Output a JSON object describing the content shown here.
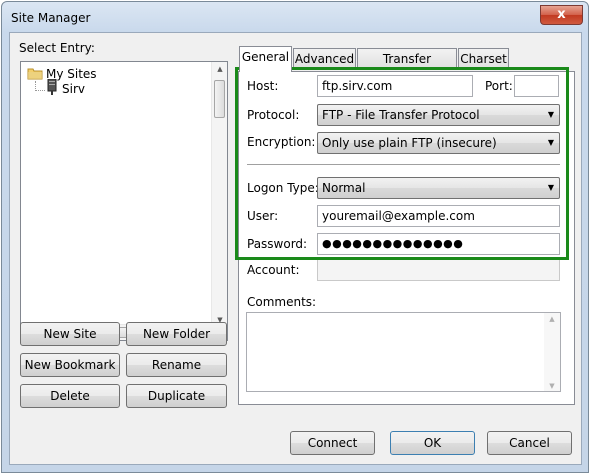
{
  "window": {
    "title": "Site Manager",
    "close_glyph": "x"
  },
  "left": {
    "select_label": "Select Entry:",
    "tree": {
      "root": "My Sites",
      "child": "Sirv"
    },
    "buttons": {
      "new_site": "New Site",
      "new_folder": "New Folder",
      "new_bookmark": "New Bookmark",
      "rename": "Rename",
      "delete": "Delete",
      "duplicate": "Duplicate"
    }
  },
  "tabs": [
    "General",
    "Advanced",
    "Transfer Settings",
    "Charset"
  ],
  "form": {
    "host_label": "Host:",
    "host_value": "ftp.sirv.com",
    "port_label": "Port:",
    "port_value": "",
    "protocol_label": "Protocol:",
    "protocol_value": "FTP - File Transfer Protocol",
    "encryption_label": "Encryption:",
    "encryption_value": "Only use plain FTP (insecure)",
    "logon_label": "Logon Type:",
    "logon_value": "Normal",
    "user_label": "User:",
    "user_value": "youremail@example.com",
    "password_label": "Password:",
    "password_value": "●●●●●●●●●●●●●●",
    "account_label": "Account:",
    "comments_label": "Comments:"
  },
  "footer": {
    "connect": "Connect",
    "ok": "OK",
    "cancel": "Cancel"
  },
  "colors": {
    "highlight": "#1a8a1a",
    "close_button": "#c13a21"
  }
}
